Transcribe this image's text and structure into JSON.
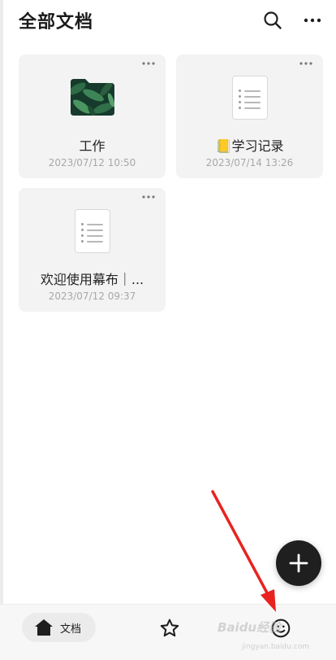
{
  "header": {
    "title": "全部文档",
    "search_icon": "search-icon",
    "more_icon": "more-horizontal-icon"
  },
  "documents": [
    {
      "type": "folder",
      "name": "工作",
      "date": "2023/07/12 10:50"
    },
    {
      "type": "document",
      "name": "📒学习记录",
      "date": "2023/07/14 13:26"
    },
    {
      "type": "document",
      "name": "欢迎使用幕布｜...",
      "date": "2023/07/12 09:37"
    }
  ],
  "fab": {
    "icon": "plus-icon"
  },
  "bottom_nav": {
    "docs_label": "文档",
    "docs_icon": "home-icon",
    "favorites_icon": "star-icon",
    "profile_icon": "smile-icon"
  },
  "watermark": {
    "main": "Baidu经验",
    "sub": "jingyan.baidu.com"
  },
  "colors": {
    "annotation_arrow": "#e8231f",
    "fab_background": "#1f1f1f",
    "card_background": "#f3f3f3"
  }
}
